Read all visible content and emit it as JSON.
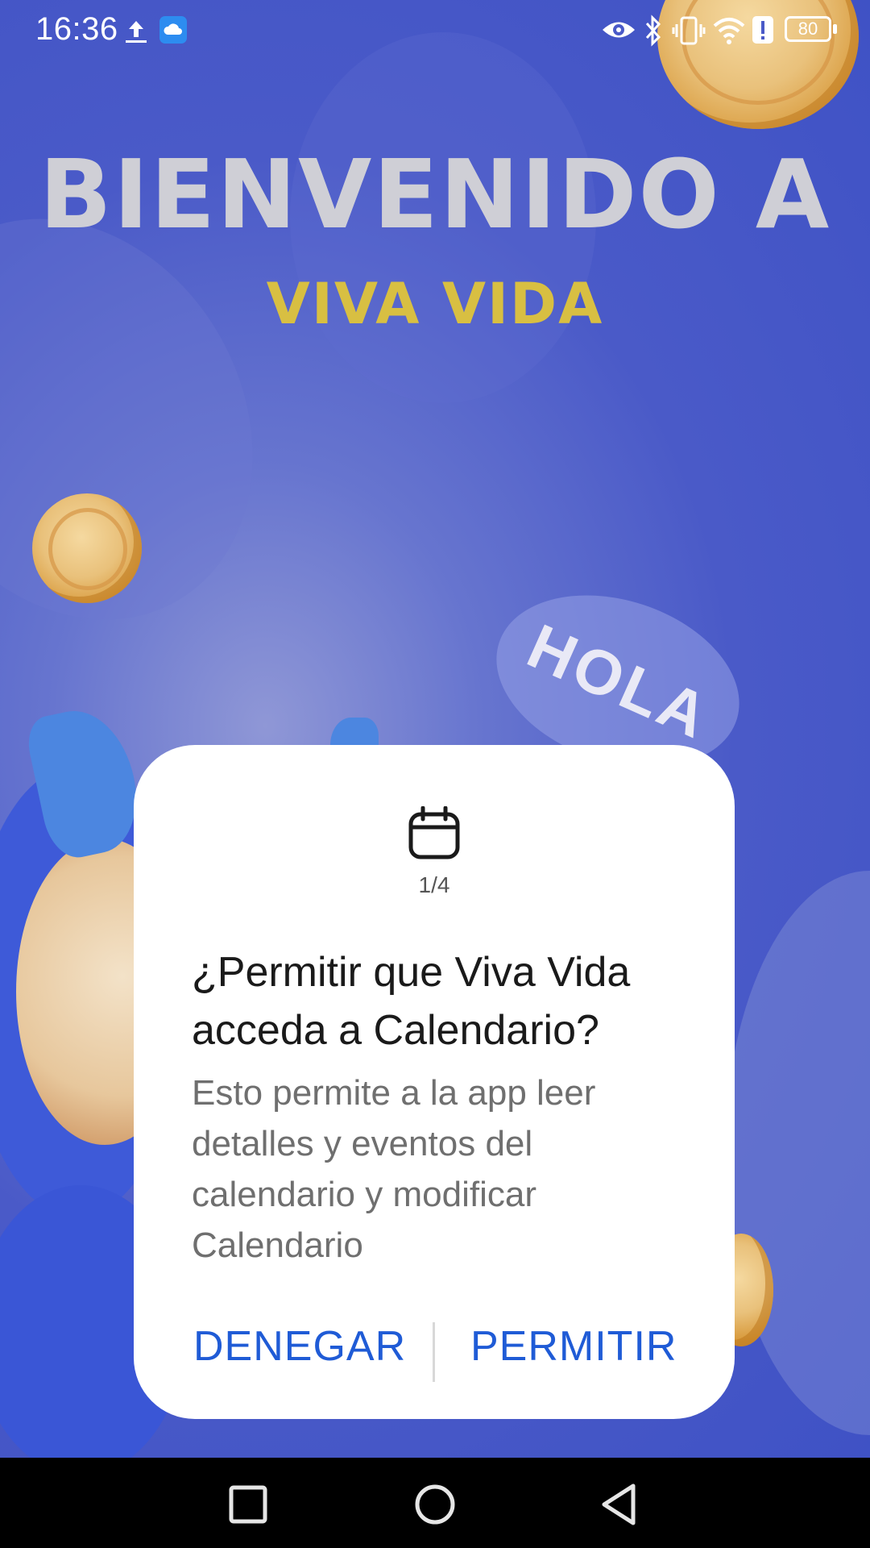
{
  "status_bar": {
    "time": "16:36",
    "battery": "80",
    "icons": [
      "upload-icon",
      "cloud-app-icon",
      "eye-icon",
      "bluetooth-icon",
      "vibrate-icon",
      "wifi-icon",
      "alert-icon",
      "battery-icon"
    ]
  },
  "welcome": {
    "title": "BIENVENIDO A",
    "subtitle": "VIVA VIDA",
    "bubble_text": "HOLA"
  },
  "dialog": {
    "icon": "calendar-icon",
    "counter": "1/4",
    "title": "¿Permitir que Viva Vida acceda a Calendario?",
    "body": "Esto permite a la app leer detalles y eventos del calendario y modificar Calendario",
    "deny_label": "DENEGAR",
    "allow_label": "PERMITIR"
  },
  "nav_bar": {
    "buttons": [
      "recents-button",
      "home-button",
      "back-button"
    ]
  },
  "colors": {
    "background": "#4657c7",
    "title": "#cfcfd6",
    "subtitle": "#d8bf42",
    "accent": "#1f5bd6",
    "dialog": "#ffffff"
  }
}
